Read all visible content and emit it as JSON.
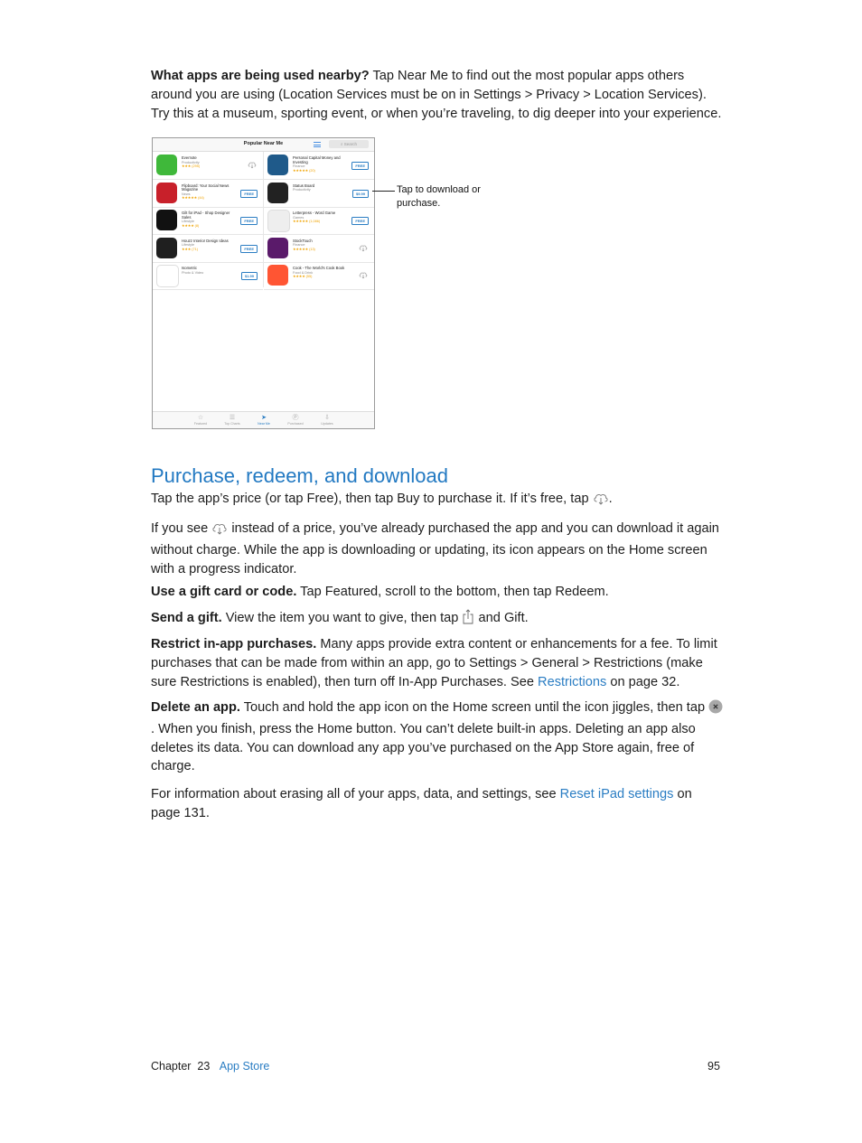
{
  "intro": {
    "bold": "What apps are being used nearby?",
    "text": " Tap Near Me to find out the most popular apps others around you are using (Location Services must be on in Settings > Privacy > Location Services). Try this at a museum, sporting event, or when you’re traveling, to dig deeper into your experience."
  },
  "screenshot": {
    "nav_title": "Popular Near Me",
    "search_placeholder": "Search",
    "apps": [
      {
        "name": "Evernote",
        "category": "Productivity",
        "rating": "★★★ (295)",
        "action": "download",
        "label": "",
        "icon_color": "#3fb83a"
      },
      {
        "name": "Personal Capital Money and Investing",
        "category": "Finance",
        "rating": "★★★★★ (20)",
        "action": "button",
        "label": "FREE",
        "icon_color": "#1f5a8a"
      },
      {
        "name": "Flipboard: Your Social News Magazine",
        "category": "News",
        "rating": "★★★★★ (44)",
        "action": "button",
        "label": "FREE",
        "icon_color": "#c8202a"
      },
      {
        "name": "Status Board",
        "category": "Productivity",
        "rating": "",
        "action": "button",
        "label": "$9.99",
        "icon_color": "#222222"
      },
      {
        "name": "Gilt for iPad - Shop Designer Sales",
        "category": "Lifestyle",
        "rating": "★★★★ (8)",
        "action": "button",
        "label": "FREE",
        "icon_color": "#111111"
      },
      {
        "name": "Letterpress - Word Game",
        "category": "Games",
        "rating": "★★★★★ (1,086)",
        "action": "button",
        "label": "FREE",
        "icon_color": "#eeeeee"
      },
      {
        "name": "Houzz Interior Design Ideas",
        "category": "Lifestyle",
        "rating": "★★★ (71)",
        "action": "button",
        "label": "FREE",
        "icon_color": "#1f1f1f"
      },
      {
        "name": "StockTouch",
        "category": "Finance",
        "rating": "★★★★★ (13)",
        "action": "download",
        "label": "",
        "icon_color": "#5a1a6a"
      },
      {
        "name": "Isometric",
        "category": "Photo & Video",
        "rating": "",
        "action": "button",
        "label": "$1.99",
        "icon_color": "#ffffff"
      },
      {
        "name": "Cook - The World's Cook Book",
        "category": "Food & Drink",
        "rating": "★★★★ (55)",
        "action": "download",
        "label": "",
        "icon_color": "#ff5533"
      }
    ],
    "tabs": [
      {
        "label": "Featured",
        "glyph": "☆"
      },
      {
        "label": "Top Charts",
        "glyph": "☰"
      },
      {
        "label": "Near Me",
        "glyph": "➤"
      },
      {
        "label": "Purchased",
        "glyph": "Ⓟ"
      },
      {
        "label": "Updates",
        "glyph": "⇩"
      }
    ],
    "active_tab": "Near Me"
  },
  "callout": "Tap to download or purchase.",
  "section": {
    "title": "Purchase, redeem, and download",
    "p1_a": "Tap the app’s price (or tap Free), then tap Buy to purchase it. If it’s free, tap ",
    "p1_b": ".",
    "p2_a": "If you see ",
    "p2_b": " instead of a price, you’ve already purchased the app and you can download it again without charge. While the app is downloading or updating, its icon appears on the Home screen with a progress indicator.",
    "gift_card_bold": "Use a gift card or code.",
    "gift_card_text": " Tap Featured, scroll to the bottom, then tap Redeem.",
    "send_gift_bold": "Send a gift.",
    "send_gift_a": " View the item you want to give, then tap ",
    "send_gift_b": " and Gift.",
    "restrict_bold": "Restrict in-app purchases.",
    "restrict_a": " Many apps provide extra content or enhancements for a fee. To limit purchases that can be made from within an app, go to Settings > General > Restrictions (make sure Restrictions is enabled), then turn off In-App Purchases. See ",
    "restrict_link": "Restrictions",
    "restrict_b": " on page 32.",
    "delete_bold": "Delete an app.",
    "delete_a": " Touch and hold the app icon on the Home screen until the icon jiggles, then tap ",
    "delete_b": ". When you finish, press the Home button. You can’t delete built-in apps. Deleting an app also deletes its data. You can download any app you’ve purchased on the App Store again, free of charge.",
    "reset_a": "For information about erasing all of your apps, data, and settings, see ",
    "reset_link": "Reset iPad settings",
    "reset_b": " on page 131."
  },
  "footer": {
    "chapter_label": "Chapter  23",
    "chapter_title": "App Store",
    "page_number": "95"
  }
}
